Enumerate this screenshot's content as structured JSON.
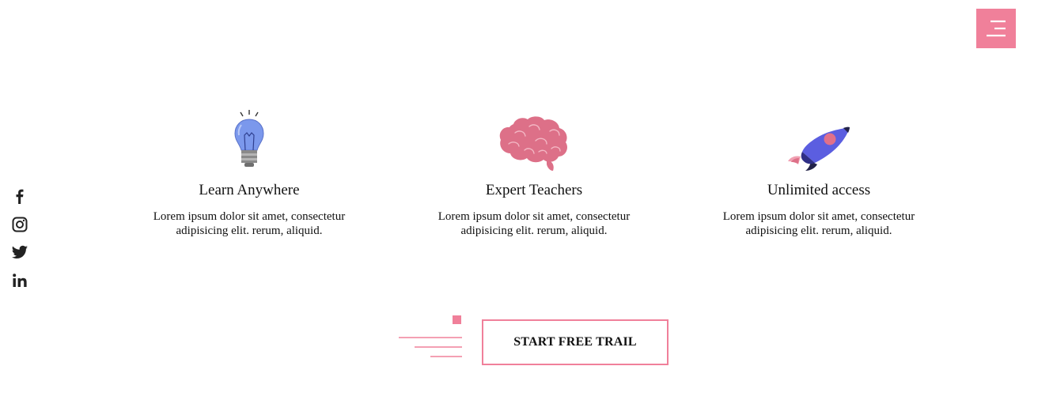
{
  "header": {
    "menu_icon": "hamburger-menu-icon",
    "accent_color": "#f0809a"
  },
  "social": [
    {
      "icon": "facebook-icon"
    },
    {
      "icon": "instagram-icon"
    },
    {
      "icon": "twitter-icon"
    },
    {
      "icon": "linkedin-icon"
    }
  ],
  "features": [
    {
      "icon": "lightbulb-icon",
      "title": "Learn Anywhere",
      "text": "Lorem ipsum dolor sit amet, consectetur adipisicing elit. rerum, aliquid."
    },
    {
      "icon": "brain-icon",
      "title": "Expert Teachers",
      "text": "Lorem ipsum dolor sit amet, consectetur adipisicing elit. rerum, aliquid."
    },
    {
      "icon": "rocket-icon",
      "title": "Unlimited access",
      "text": "Lorem ipsum dolor sit amet, consectetur adipisicing elit. rerum, aliquid."
    }
  ],
  "cta": {
    "label": "START FREE TRAIL"
  }
}
